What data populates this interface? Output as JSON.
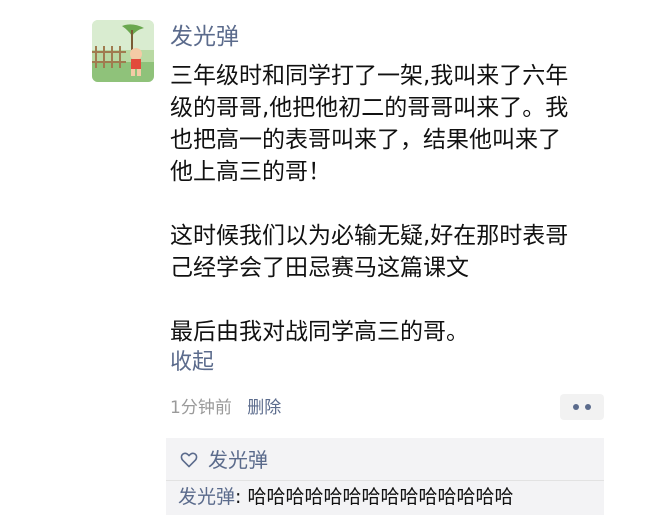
{
  "post": {
    "author": "发光弹",
    "paragraphs": [
      "三年级时和同学打了一架,我叫来了六年\n级的哥哥,他把他初二的哥哥叫来了。我\n也把高一的表哥叫来了，结果他叫来了\n他上高三的哥！",
      "这时候我们以为必输无疑,好在那时表哥\n己经学会了田忌赛马这篇课文",
      "最后由我对战同学高三的哥。"
    ],
    "collapse_label": "收起",
    "time": "1分钟前",
    "delete_label": "删除"
  },
  "interactions": {
    "likes": [
      "发光弹"
    ],
    "comments": [
      {
        "author": "发光弹",
        "separator": ": ",
        "text": "哈哈哈哈哈哈哈哈哈哈哈哈哈哈"
      }
    ]
  },
  "colors": {
    "link": "#5b6b8c",
    "meta_gray": "#9a9a9a",
    "panel_bg": "#f3f3f5"
  },
  "icons": {
    "avatar": "cartoon-boy-avatar",
    "more": "more-dots-icon",
    "like": "heart-icon"
  }
}
